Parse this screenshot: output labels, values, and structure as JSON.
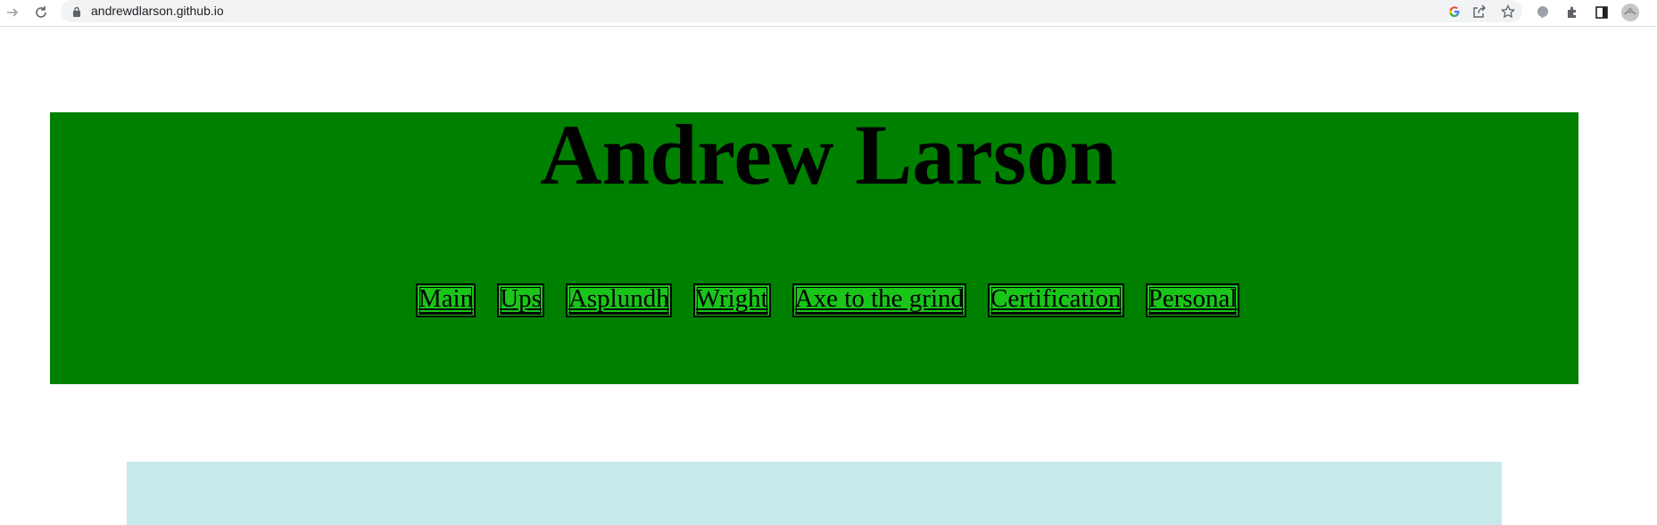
{
  "browser": {
    "url": "andrewdlarson.github.io"
  },
  "header": {
    "title": "Andrew Larson",
    "background": "#008000"
  },
  "nav": {
    "items": [
      {
        "label": "Main"
      },
      {
        "label": "Ups"
      },
      {
        "label": "Asplundh"
      },
      {
        "label": "Wright"
      },
      {
        "label": "Axe to the grind"
      },
      {
        "label": "Certification"
      },
      {
        "label": "Personal"
      }
    ],
    "button_color": "#1ac51a"
  },
  "content": {
    "panel_color": "#c6eaea"
  }
}
